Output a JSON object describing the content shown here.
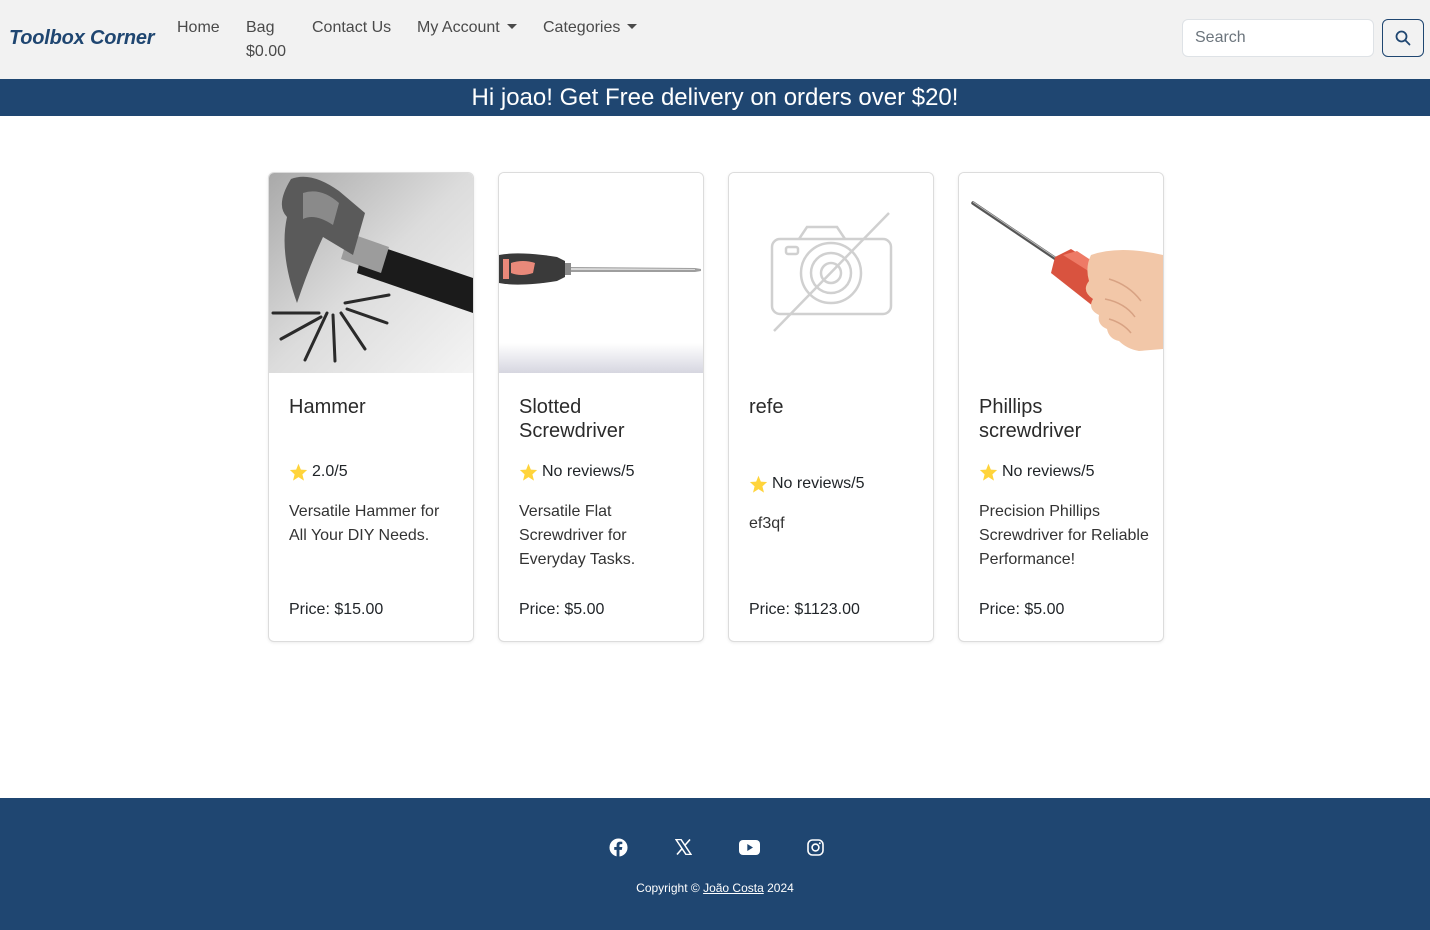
{
  "brand": "Toolbox Corner",
  "nav": {
    "home": "Home",
    "bag": "Bag",
    "bag_total": "$0.00",
    "contact": "Contact Us",
    "account": "My Account",
    "categories": "Categories"
  },
  "search": {
    "placeholder": "Search",
    "value": ""
  },
  "banner": "Hi joao! Get Free delivery on orders over $20!",
  "products": [
    {
      "name": "Hammer",
      "rating": "2.0/5",
      "description": "Versatile Hammer for All Your DIY Needs.",
      "price": "Price: $15.00",
      "image": "hammer-photo"
    },
    {
      "name": "Slotted Screwdriver",
      "rating": "No reviews/5",
      "description": "Versatile Flat Screwdriver for Everyday Tasks.",
      "price": "Price: $5.00",
      "image": "slotted-screwdriver-photo"
    },
    {
      "name": "refe",
      "rating": "No reviews/5",
      "description": "ef3qf",
      "price": "Price: $1123.00",
      "image": "no-image-placeholder"
    },
    {
      "name": "Phillips screwdriver",
      "rating": "No reviews/5",
      "description": "Precision Phillips Screwdriver for Reliable Performance!",
      "price": "Price: $5.00",
      "image": "phillips-screwdriver-photo"
    }
  ],
  "footer": {
    "social": [
      "facebook-icon",
      "x-icon",
      "youtube-icon",
      "instagram-icon"
    ],
    "copyright_prefix": "Copyright ©",
    "author": "João Costa",
    "year": "2024"
  },
  "colors": {
    "primary": "#1f4671",
    "navbar_bg": "#f2f2f2",
    "star": "#ffd43b"
  }
}
